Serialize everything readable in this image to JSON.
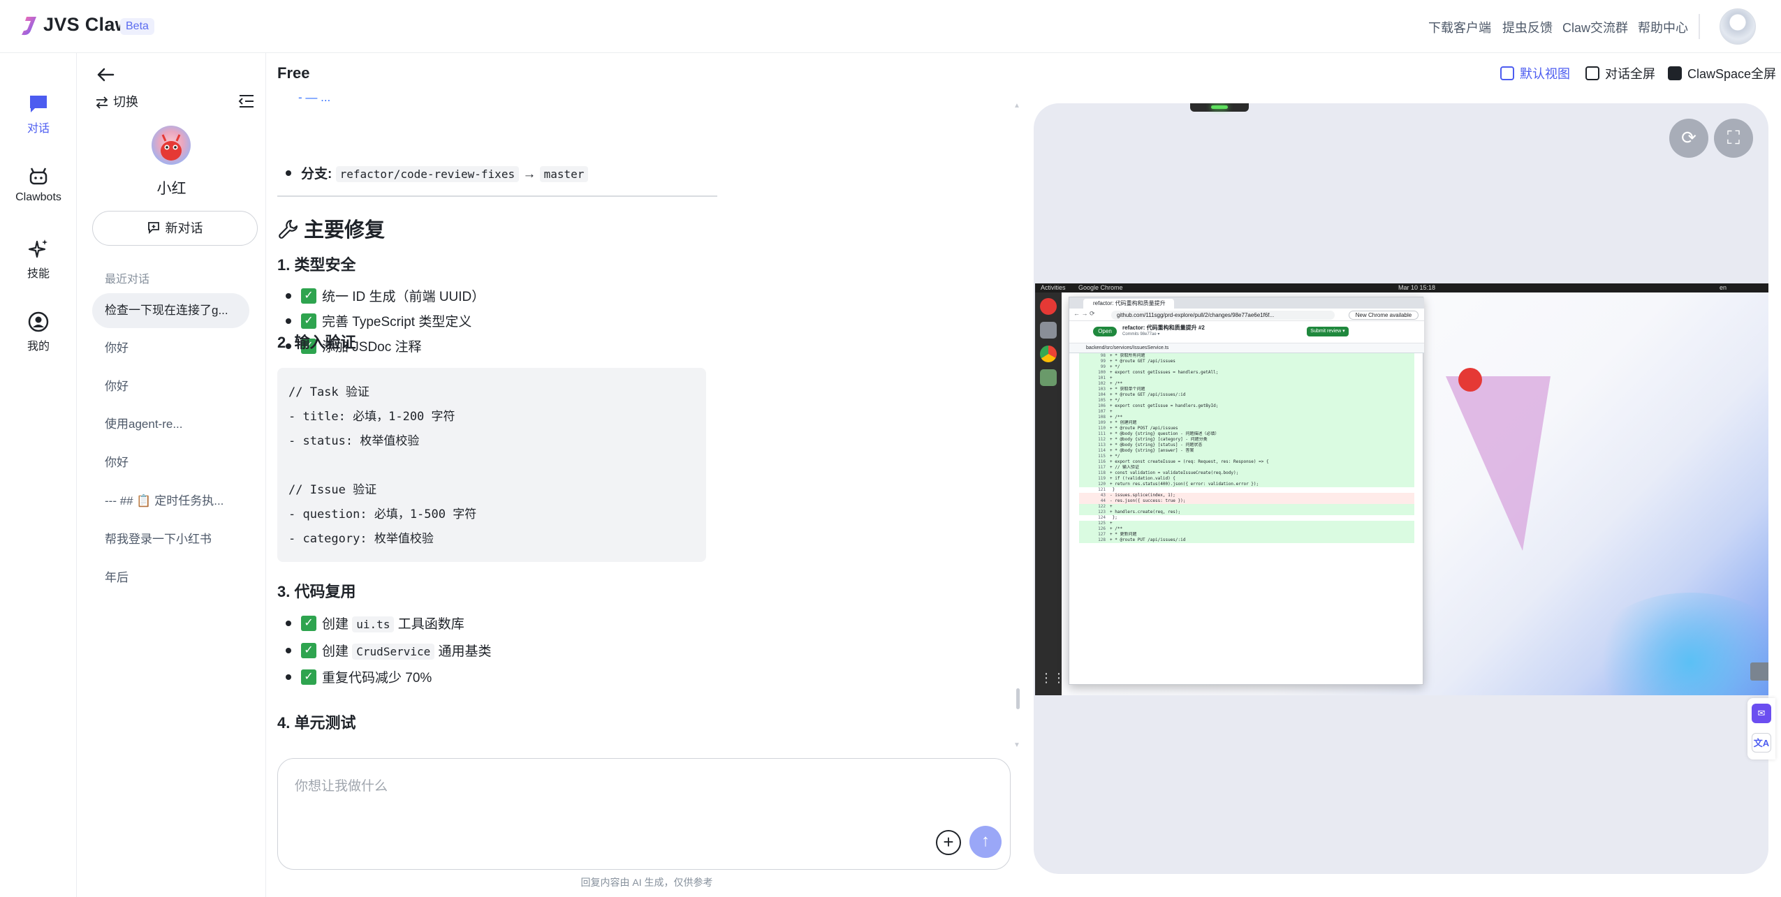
{
  "header": {
    "app_title": "JVS Claw",
    "badge": "Beta",
    "links": [
      "下载客户端",
      "提虫反馈",
      "Claw交流群",
      "帮助中心"
    ]
  },
  "nav": {
    "items": [
      {
        "label": "对话",
        "icon": "chat-icon",
        "active": true
      },
      {
        "label": "Clawbots",
        "icon": "bot-icon",
        "active": false
      },
      {
        "label": "技能",
        "icon": "sparkle-icon",
        "active": false
      },
      {
        "label": "我的",
        "icon": "user-icon",
        "active": false
      }
    ]
  },
  "sidebar": {
    "switch_label": "切换",
    "bot_name": "小红",
    "new_chat_label": "新对话",
    "recent_title": "最近对话",
    "history": [
      "检查一下现在连接了g...",
      "你好",
      "你好",
      "使用agent-re...",
      "你好",
      "--- ## 📋 定时任务执...",
      "帮我登录一下小红书",
      "年后"
    ]
  },
  "main": {
    "title": "Free",
    "branch_label": "分支",
    "branch_from": "refactor/code-review-fixes",
    "branch_arrow": "→",
    "branch_to": "master",
    "section_title": "主要修复",
    "s1_title": "1. 类型安全",
    "s1_items": [
      "统一 ID 生成（前端 UUID）",
      "完善 TypeScript 类型定义",
      "添加 JSDoc 注释"
    ],
    "s2_title": "2. 输入验证",
    "code_block": "// Task 验证\n- title: 必填，1-200 字符\n- status: 枚举值校验\n\n// Issue 验证\n- question: 必填，1-500 字符\n- category: 枚举值校验",
    "s3_title": "3. 代码复用",
    "s3_items": [
      {
        "pre": "创建 ",
        "code": "ui.ts",
        "post": " 工具函数库"
      },
      {
        "pre": "创建 ",
        "code": "CrudService",
        "post": " 通用基类"
      },
      {
        "pre": "重复代码减少 70%",
        "code": "",
        "post": ""
      }
    ],
    "s4_title": "4. 单元测试",
    "input_placeholder": "你想让我做什么",
    "disclaimer": "回复内容由 AI 生成，仅供参考"
  },
  "view_controls": {
    "default_view": "默认视图",
    "chat_fullscreen": "对话全屏",
    "clawspace_fullscreen": "ClawSpace全屏"
  },
  "desktop": {
    "activities": "Activities",
    "app_name": "Google Chrome",
    "clock": "Mar 10  15:18",
    "lang": "en",
    "tab_title": "refactor: 代码重构和质量提升",
    "url": "github.com/111sgg/prd-explore/pull/2/changes/98e77ae6e1f6f...",
    "update_label": "New Chrome available",
    "pr_state": "Open",
    "pr_title": "refactor: 代码重构和质量提升 #2",
    "pr_sub": "Commits 98e77ae ▾",
    "review_label": "Submit review ▾",
    "file_path": "backend/src/services/IssuesService.ts",
    "diff_lines": [
      {
        "n": "98",
        "t": "add",
        "c": "+   * 获取所有问题"
      },
      {
        "n": "99",
        "t": "add",
        "c": "+   * @route GET /api/issues"
      },
      {
        "n": "99",
        "t": "add",
        "c": "+   */"
      },
      {
        "n": "100",
        "t": "add",
        "c": "+ export const getIssues = handlers.getAll;"
      },
      {
        "n": "101",
        "t": "add",
        "c": "+"
      },
      {
        "n": "102",
        "t": "add",
        "c": "+ /**"
      },
      {
        "n": "103",
        "t": "add",
        "c": "+   * 获取单个问题"
      },
      {
        "n": "104",
        "t": "add",
        "c": "+   * @route GET /api/issues/:id"
      },
      {
        "n": "105",
        "t": "add",
        "c": "+   */"
      },
      {
        "n": "106",
        "t": "add",
        "c": "+ export const getIssue = handlers.getById;"
      },
      {
        "n": "107",
        "t": "add",
        "c": "+"
      },
      {
        "n": "108",
        "t": "add",
        "c": "+ /**"
      },
      {
        "n": "109",
        "t": "add",
        "c": "+   * 创建问题"
      },
      {
        "n": "110",
        "t": "add",
        "c": "+   * @route POST /api/issues"
      },
      {
        "n": "111",
        "t": "add",
        "c": "+   * @body {string} question - 问题描述（必填）"
      },
      {
        "n": "112",
        "t": "add",
        "c": "+   * @body {string} [category] - 问题分类"
      },
      {
        "n": "113",
        "t": "add",
        "c": "+   * @body {string} [status] - 问题状态"
      },
      {
        "n": "114",
        "t": "add",
        "c": "+   * @body {string} [answer] - 答案"
      },
      {
        "n": "115",
        "t": "add",
        "c": "+   */"
      },
      {
        "n": "116",
        "t": "add",
        "c": "+ export const createIssue = (req: Request, res: Response) => {"
      },
      {
        "n": "117",
        "t": "add",
        "c": "+   // 输入验证"
      },
      {
        "n": "118",
        "t": "add",
        "c": "+   const validation = validateIssueCreate(req.body);"
      },
      {
        "n": "119",
        "t": "add",
        "c": "+   if (!validation.valid) {"
      },
      {
        "n": "120",
        "t": "add",
        "c": "+     return res.status(400).json({ error: validation.error });"
      },
      {
        "n": "121",
        "t": "ctx",
        "c": "    }"
      },
      {
        "n": "43",
        "t": "del",
        "c": "-   issues.splice(index, 1);"
      },
      {
        "n": "44",
        "t": "del",
        "c": "-   res.json({ success: true });"
      },
      {
        "n": "122",
        "t": "add",
        "c": "+"
      },
      {
        "n": "123",
        "t": "add",
        "c": "+   handlers.create(req, res);"
      },
      {
        "n": "124",
        "t": "ctx",
        "c": "  };"
      },
      {
        "n": "125",
        "t": "add",
        "c": "+"
      },
      {
        "n": "126",
        "t": "add",
        "c": "+ /**"
      },
      {
        "n": "127",
        "t": "add",
        "c": "+   * 更新问题"
      },
      {
        "n": "128",
        "t": "add",
        "c": "+   * @route PUT /api/issues/:id"
      }
    ]
  },
  "colors": {
    "accent": "#4c5cf0",
    "check_green": "#2ea44f",
    "send_button": "#9aa7f7",
    "diff_add": "#dafbe1",
    "diff_del": "#ffebe9"
  }
}
